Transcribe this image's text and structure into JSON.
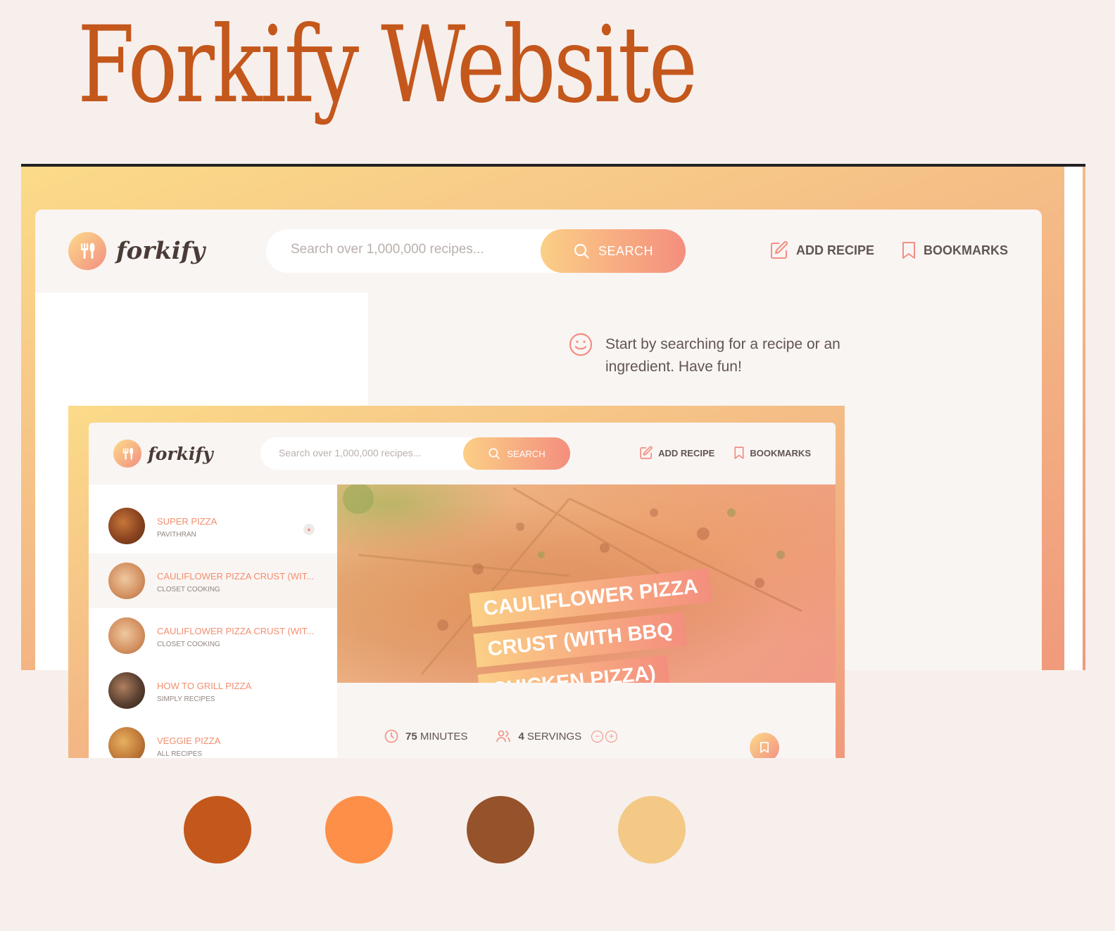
{
  "page": {
    "title": "Forkify Website"
  },
  "screen_large": {
    "logo_text": "forkify",
    "search_placeholder": "Search over 1,000,000 recipes...",
    "search_button": "SEARCH",
    "nav": {
      "add_recipe": "ADD RECIPE",
      "bookmarks": "BOOKMARKS"
    },
    "message": "Start by searching for a recipe or an ingredient. Have fun!"
  },
  "screen_small": {
    "logo_text": "forkify",
    "search_placeholder": "Search over 1,000,000 recipes...",
    "search_button": "SEARCH",
    "nav": {
      "add_recipe": "ADD RECIPE",
      "bookmarks": "BOOKMARKS"
    },
    "results": [
      {
        "name": "SUPER PIZZA",
        "publisher": "PAVITHRAN",
        "user_generated": true
      },
      {
        "name": "CAULIFLOWER PIZZA CRUST (WIT...",
        "publisher": "CLOSET COOKING",
        "active": true
      },
      {
        "name": "CAULIFLOWER PIZZA CRUST (WIT...",
        "publisher": "CLOSET COOKING"
      },
      {
        "name": "HOW TO GRILL PIZZA",
        "publisher": "SIMPLY RECIPES"
      },
      {
        "name": "VEGGIE PIZZA",
        "publisher": "ALL RECIPES"
      }
    ],
    "recipe": {
      "title": "CAULIFLOWER PIZZA CRUST (WITH BBQ CHICKEN PIZZA)",
      "minutes": "75",
      "minutes_label": "MINUTES",
      "servings": "4",
      "servings_label": "SERVINGS",
      "decrease": "−",
      "increase": "+"
    }
  },
  "palette": [
    "#c4571b",
    "#fd8f48",
    "#96522a",
    "#f3c985"
  ]
}
